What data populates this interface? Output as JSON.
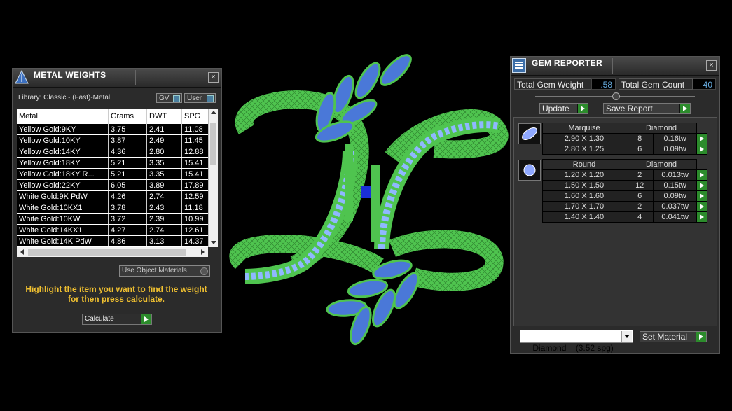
{
  "metal_weights": {
    "title": "METAL WEIGHTS",
    "library": "Library: Classic - (Fast)-Metal",
    "gv_label": "GV",
    "user_label": "User",
    "columns": [
      "Metal",
      "Grams",
      "DWT",
      "SPG"
    ],
    "rows": [
      [
        "Yellow Gold:9KY",
        "3.75",
        "2.41",
        "11.08"
      ],
      [
        "Yellow Gold:10KY",
        "3.87",
        "2.49",
        "11.45"
      ],
      [
        "Yellow Gold:14KY",
        "4.36",
        "2.80",
        "12.88"
      ],
      [
        "Yellow Gold:18KY",
        "5.21",
        "3.35",
        "15.41"
      ],
      [
        "Yellow Gold:18KY R...",
        "5.21",
        "3.35",
        "15.41"
      ],
      [
        "Yellow Gold:22KY",
        "6.05",
        "3.89",
        "17.89"
      ],
      [
        "White Gold:9K PdW",
        "4.26",
        "2.74",
        "12.59"
      ],
      [
        "White Gold:10KX1",
        "3.78",
        "2.43",
        "11.18"
      ],
      [
        "White Gold:10KW",
        "3.72",
        "2.39",
        "10.99"
      ],
      [
        "White Gold:14KX1",
        "4.27",
        "2.74",
        "12.61"
      ],
      [
        "White Gold:14K PdW",
        "4.86",
        "3.13",
        "14.37"
      ]
    ],
    "use_object_materials": "Use Object Materials",
    "hint": "Highlight the item you want to find the weight for then press calculate.",
    "calculate_label": "Calculate",
    "hint_color": "#f0c030"
  },
  "gem_reporter": {
    "title": "GEM REPORTER",
    "total_weight_label": "Total Gem Weight",
    "total_weight_value": ".58",
    "total_count_label": "Total Gem Count",
    "total_count_value": "40",
    "update_label": "Update",
    "save_report_label": "Save Report",
    "groups": [
      {
        "shape": "Marquise",
        "material": "Diamond",
        "rows": [
          [
            "2.90 X 1.30",
            "8",
            "0.16tw"
          ],
          [
            "2.80 X 1.25",
            "6",
            "0.09tw"
          ]
        ]
      },
      {
        "shape": "Round",
        "material": "Diamond",
        "rows": [
          [
            "1.20 X 1.20",
            "2",
            "0.013tw"
          ],
          [
            "1.50 X 1.50",
            "12",
            "0.15tw"
          ],
          [
            "1.60 X 1.60",
            "6",
            "0.09tw"
          ],
          [
            "1.70 X 1.70",
            "2",
            "0.037tw"
          ],
          [
            "1.40 X 1.40",
            "4",
            "0.041tw"
          ]
        ]
      }
    ],
    "material_select": "Diamond    (3.52 spg)",
    "set_material_label": "Set Material"
  },
  "colors": {
    "wire_green": "#52c852",
    "gem_blue": "#4a78d8",
    "accent_green": "#2c8c2c"
  }
}
